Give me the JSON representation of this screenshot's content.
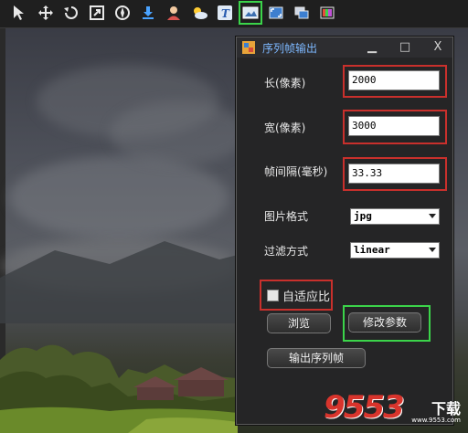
{
  "toolbar": {
    "buttons": [
      {
        "icon": "pointer-icon"
      },
      {
        "icon": "move-icon"
      },
      {
        "icon": "rotate-icon"
      },
      {
        "icon": "scale-icon"
      },
      {
        "icon": "compass-icon"
      },
      {
        "icon": "character-icon"
      },
      {
        "icon": "download-icon"
      },
      {
        "icon": "weather-icon"
      },
      {
        "icon": "text-icon"
      },
      {
        "icon": "image-sequence-icon"
      },
      {
        "icon": "fullscreen-icon"
      },
      {
        "icon": "windows-icon"
      },
      {
        "icon": "palette-icon"
      }
    ],
    "active_index": 9
  },
  "dialog": {
    "title": "序列帧输出",
    "controls": {
      "minimize": "▁",
      "maximize": "□",
      "close": "X"
    },
    "fields": {
      "width_label": "长(像素)",
      "width_value": "2000",
      "height_label": "宽(像素)",
      "height_value": "3000",
      "interval_label": "帧间隔(毫秒)",
      "interval_value": "33.33",
      "format_label": "图片格式",
      "format_value": "jpg",
      "filter_label": "过滤方式",
      "filter_value": "linear"
    },
    "checkbox_label": "自适应比",
    "checkbox_checked": false,
    "browse_button": "浏览",
    "modify_button": "修改参数",
    "export_button": "输出序列帧"
  },
  "watermark": {
    "number": "9553",
    "text": "下载",
    "url": "www.9553.com"
  },
  "colors": {
    "highlight_red": "#c9302c",
    "highlight_green": "#3bd44a",
    "title_blue": "#7db8ff"
  }
}
